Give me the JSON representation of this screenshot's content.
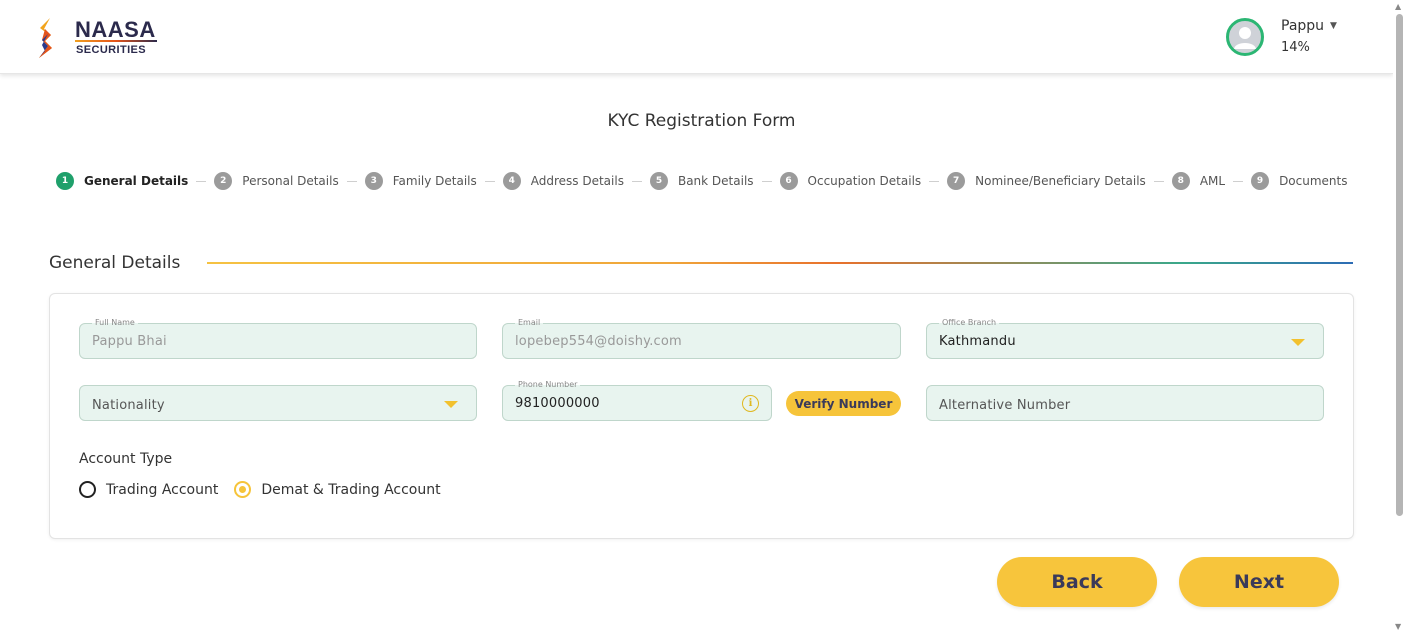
{
  "brand": {
    "name": "NAASA",
    "sub": "SECURITIES"
  },
  "user": {
    "name": "Pappu",
    "progress": "14%"
  },
  "title": "KYC Registration Form",
  "steps": [
    {
      "num": "1",
      "label": "General Details"
    },
    {
      "num": "2",
      "label": "Personal Details"
    },
    {
      "num": "3",
      "label": "Family Details"
    },
    {
      "num": "4",
      "label": "Address Details"
    },
    {
      "num": "5",
      "label": "Bank Details"
    },
    {
      "num": "6",
      "label": "Occupation Details"
    },
    {
      "num": "7",
      "label": "Nominee/Beneficiary Details"
    },
    {
      "num": "8",
      "label": "AML"
    },
    {
      "num": "9",
      "label": "Documents"
    }
  ],
  "active_step": 1,
  "section": {
    "title": "General Details"
  },
  "form": {
    "full_name": {
      "label": "Full Name",
      "value": "Pappu  Bhai"
    },
    "email": {
      "label": "Email",
      "value": "lopebep554@doishy.com"
    },
    "office_branch": {
      "label": "Office Branch",
      "value": "Kathmandu"
    },
    "nationality": {
      "placeholder": "Nationality"
    },
    "phone": {
      "label": "Phone Number",
      "value": "9810000000"
    },
    "verify_label": "Verify Number",
    "alt_number": {
      "placeholder": "Alternative Number"
    },
    "account_type": {
      "label": "Account Type",
      "options": [
        "Trading Account",
        "Demat & Trading Account"
      ],
      "selected": "Demat & Trading Account"
    }
  },
  "buttons": {
    "back": "Back",
    "next": "Next"
  },
  "colors": {
    "accent": "#f6c43a",
    "active_step": "#1fa06b",
    "field_bg": "#e8f4ef"
  }
}
